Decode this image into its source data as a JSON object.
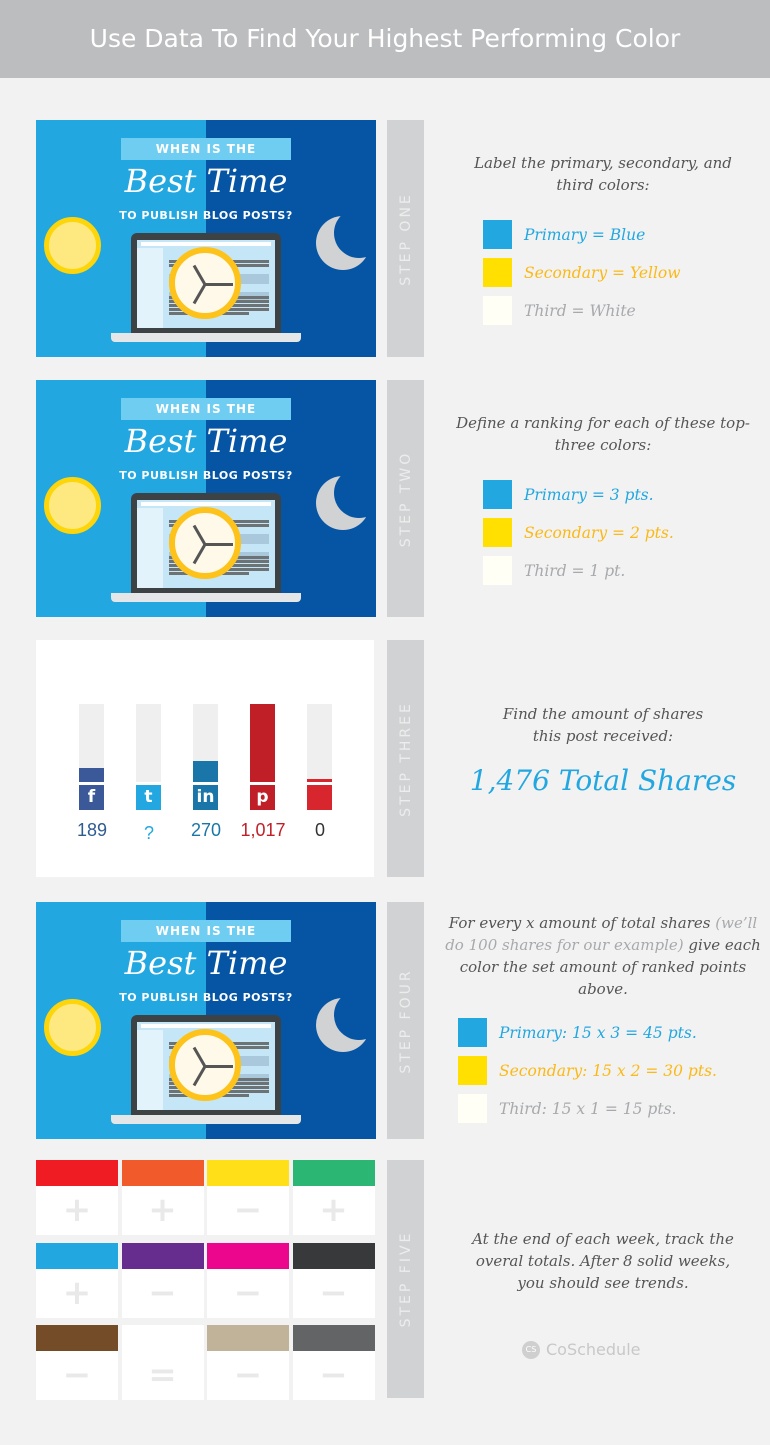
{
  "header": {
    "title": "Use Data To Find Your Highest Performing Color"
  },
  "blog_image": {
    "banner": "WHEN IS THE",
    "title": "Best Time",
    "subtitle": "TO PUBLISH BLOG POSTS?"
  },
  "colors": {
    "primary": "#22a7e0",
    "secondary": "#ffe000",
    "third": "#fffff5",
    "primary_text": "#22a7e0",
    "secondary_text": "#fbb917",
    "third_text": "#a7a9ac",
    "dark_blue": "#0555a4"
  },
  "step1": {
    "label": "STEP ONE",
    "text": "Label the primary, secondary, and third colors:",
    "legend": [
      "Primary = Blue",
      "Secondary = Yellow",
      "Third = White"
    ]
  },
  "step2": {
    "label": "STEP TWO",
    "text": "Define a ranking for each of these top-three colors:",
    "legend": [
      "Primary = 3 pts.",
      "Secondary = 2 pts.",
      "Third = 1 pt."
    ]
  },
  "step3": {
    "label": "STEP THREE",
    "text": "Find the amount of shares this post received:",
    "total": "1,476 Total Shares",
    "networks": [
      {
        "icon": "facebook-icon",
        "glyph": "f",
        "value": "189",
        "count": 189,
        "color": "#3b5998",
        "text_color": "#2f5b93"
      },
      {
        "icon": "twitter-icon",
        "glyph": "t",
        "value": "?",
        "count": 0,
        "color": "#22a7e0",
        "text_color": "#22a7e0"
      },
      {
        "icon": "linkedin-icon",
        "glyph": "in",
        "value": "270",
        "count": 270,
        "color": "#1a76a8",
        "text_color": "#1a76a8"
      },
      {
        "icon": "pinterest-icon",
        "glyph": "p",
        "value": "1,017",
        "count": 1017,
        "color": "#c11f27",
        "text_color": "#c11f27"
      },
      {
        "icon": "share-icon",
        "glyph": "",
        "value": "0",
        "count": 0,
        "color": "#d7262d",
        "text_color": "#333333"
      }
    ]
  },
  "step4": {
    "label": "STEP FOUR",
    "text_a": "For every x amount of total shares",
    "text_b": "(we’ll do 100 shares for our example)",
    "text_c": "give each color the set amount of ranked points above.",
    "legend": [
      "Primary: 15 x 3 = 45 pts.",
      "Secondary: 15 x 2 = 30 pts.",
      "Third: 15 x 1 = 15 pts."
    ]
  },
  "step5": {
    "label": "STEP FIVE",
    "text": "At the end of each week, track the overal totals. After 8 solid weeks, you should see trends.",
    "grid": [
      [
        {
          "color": "#ef1c24",
          "mark": "+"
        },
        {
          "color": "#f15a2b",
          "mark": "+"
        },
        {
          "color": "#ffdf17",
          "mark": "−"
        },
        {
          "color": "#2cb673",
          "mark": "+"
        }
      ],
      [
        {
          "color": "#22a7e0",
          "mark": "+"
        },
        {
          "color": "#662d8f",
          "mark": "−"
        },
        {
          "color": "#ec068d",
          "mark": "−"
        },
        {
          "color": "#37393b",
          "mark": "−"
        }
      ],
      [
        {
          "color": "#744c28",
          "mark": "−"
        },
        {
          "color": "#ffffff",
          "mark": "="
        },
        {
          "color": "#c1b399",
          "mark": "−"
        },
        {
          "color": "#636466",
          "mark": "−"
        }
      ]
    ]
  },
  "brand": {
    "logo_text": "CoSchedule",
    "logo_mark": "CS"
  }
}
